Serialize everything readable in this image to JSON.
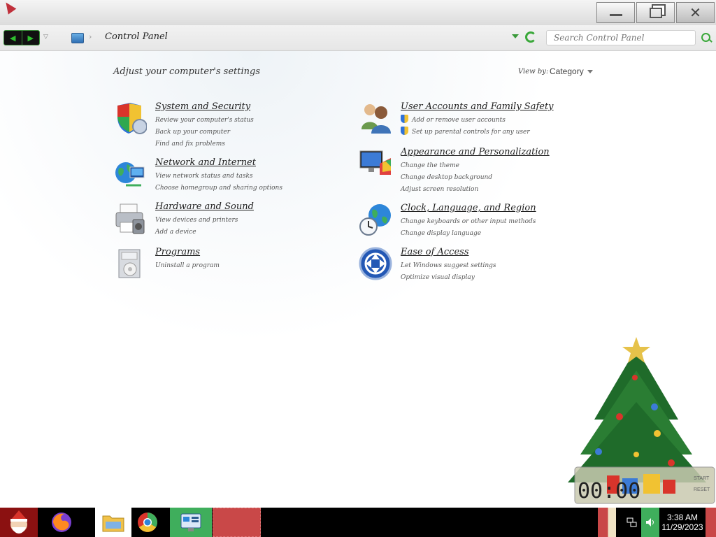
{
  "window": {
    "minimize_glyph": "—",
    "restore_glyph": "❐",
    "close_glyph": "✕"
  },
  "address_bar": {
    "back_glyph": "◀",
    "forward_glyph": "▶",
    "dropdown_glyph": "▽",
    "breadcrumb_sep": "›",
    "breadcrumb": "Control Panel",
    "search_placeholder": "Search Control Panel"
  },
  "content": {
    "heading": "Adjust your computer's settings",
    "view_by_label": "View by:",
    "view_by_value": "Category"
  },
  "categories": [
    {
      "icon": "shield-icon",
      "title": "System and Security",
      "links": [
        "Review your computer's status",
        "Back up your computer",
        "Find and fix problems"
      ]
    },
    {
      "icon": "globe-network-icon",
      "title": "Network and Internet",
      "links": [
        "View network status and tasks",
        "Choose homegroup and sharing options"
      ]
    },
    {
      "icon": "printer-icon",
      "title": "Hardware and Sound",
      "links": [
        "View devices and printers",
        "Add a device"
      ]
    },
    {
      "icon": "programs-icon",
      "title": "Programs",
      "links": [
        "Uninstall a program"
      ]
    },
    {
      "icon": "users-icon",
      "title": "User Accounts and Family Safety",
      "links": [
        "Add or remove user accounts",
        "Set up parental controls for any user"
      ]
    },
    {
      "icon": "monitor-paint-icon",
      "title": "Appearance and Personalization",
      "links": [
        "Change the theme",
        "Change desktop background",
        "Adjust screen resolution"
      ]
    },
    {
      "icon": "clock-globe-icon",
      "title": "Clock, Language, and Region",
      "links": [
        "Change keyboards or other input methods",
        "Change display language"
      ]
    },
    {
      "icon": "ease-of-access-icon",
      "title": "Ease of Access",
      "links": [
        "Let Windows suggest settings",
        "Optimize visual display"
      ]
    }
  ],
  "desktop_widget": {
    "counter_digits": "00:00",
    "start_label": "START",
    "reset_label": "RESET"
  },
  "taskbar": {
    "time": "3:38 AM",
    "date": "11/29/2023"
  },
  "colors": {
    "accent_green": "#3fae5c",
    "taskbar_red": "#c94848",
    "start_red": "#8b1111"
  }
}
